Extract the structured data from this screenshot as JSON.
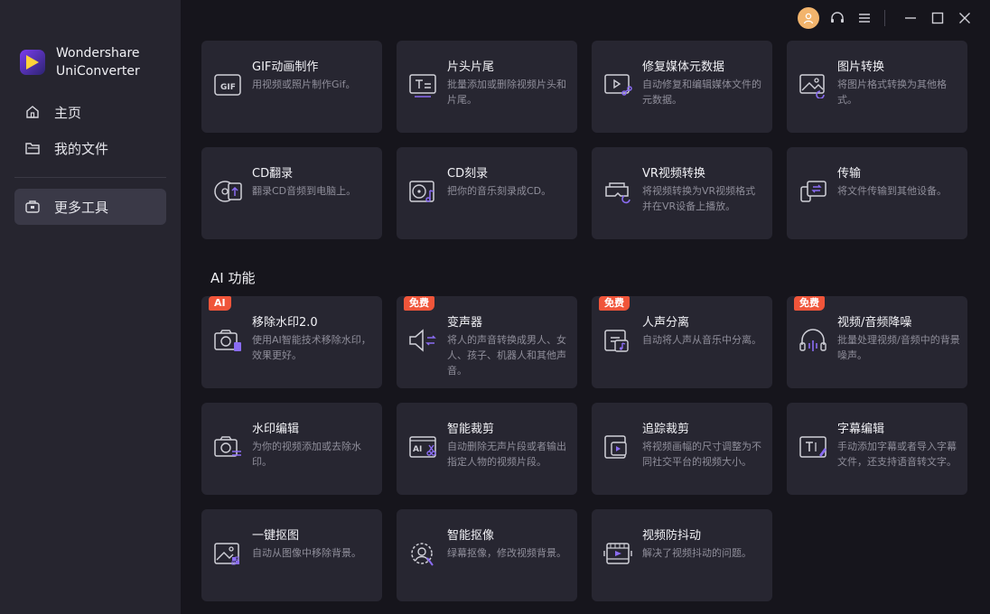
{
  "brand": {
    "line1": "Wondershare",
    "line2": "UniConverter"
  },
  "nav": [
    {
      "label": "主页",
      "icon": "home-icon"
    },
    {
      "label": "我的文件",
      "icon": "folder-icon"
    },
    {
      "label": "更多工具",
      "icon": "toolbox-icon",
      "active": true
    }
  ],
  "topbar": {
    "icons": [
      "user-avatar-icon",
      "headset-support-icon",
      "menu-icon",
      "minimize-icon",
      "maximize-icon",
      "close-icon"
    ]
  },
  "tools_top": [
    {
      "title": "GIF动画制作",
      "desc": "用视频或照片制作Gif。",
      "icon": "gif-icon"
    },
    {
      "title": "片头片尾",
      "desc": "批量添加或删除视频片头和片尾。",
      "icon": "intro-outro-icon"
    },
    {
      "title": "修复媒体元数据",
      "desc": "自动修复和编辑媒体文件的元数据。",
      "icon": "metadata-icon"
    },
    {
      "title": "图片转换",
      "desc": "将图片格式转换为其他格式。",
      "icon": "image-convert-icon"
    },
    {
      "title": "CD翻录",
      "desc": "翻录CD音频到电脑上。",
      "icon": "cd-ripper-icon"
    },
    {
      "title": "CD刻录",
      "desc": "把你的音乐刻录成CD。",
      "icon": "cd-burner-icon"
    },
    {
      "title": "VR视频转换",
      "desc": "将视频转换为VR视频格式并在VR设备上播放。",
      "icon": "vr-icon"
    },
    {
      "title": "传输",
      "desc": "将文件传输到其他设备。",
      "icon": "transfer-icon"
    }
  ],
  "ai_section_title": "AI 功能",
  "tools_ai": [
    {
      "title": "移除水印2.0",
      "desc": "使用AI智能技术移除水印，效果更好。",
      "badge": "AI",
      "icon": "watermark-remove-icon"
    },
    {
      "title": "变声器",
      "desc": "将人的声音转换成男人、女人、孩子、机器人和其他声音。",
      "badge": "免费",
      "icon": "voice-changer-icon"
    },
    {
      "title": "人声分离",
      "desc": "自动将人声从音乐中分离。",
      "badge": "免费",
      "icon": "vocal-remover-icon"
    },
    {
      "title": "视频/音频降噪",
      "desc": "批量处理视频/音频中的背景噪声。",
      "badge": "免费",
      "icon": "noise-reduction-icon"
    },
    {
      "title": "水印编辑",
      "desc": "为你的视频添加或去除水印。",
      "icon": "watermark-edit-icon"
    },
    {
      "title": "智能裁剪",
      "desc": "自动删除无声片段或者输出指定人物的视频片段。",
      "icon": "smart-trim-icon"
    },
    {
      "title": "追踪裁剪",
      "desc": "将视频画幅的尺寸调整为不同社交平台的视频大小。",
      "icon": "auto-reframe-icon"
    },
    {
      "title": "字幕编辑",
      "desc": "手动添加字幕或者导入字幕文件，还支持语音转文字。",
      "icon": "subtitle-icon"
    },
    {
      "title": "一键抠图",
      "desc": "自动从图像中移除背景。",
      "icon": "bg-remover-icon"
    },
    {
      "title": "智能抠像",
      "desc": "绿幕抠像，修改视频背景。",
      "icon": "smart-cutout-icon"
    },
    {
      "title": "视频防抖动",
      "desc": "解决了视频抖动的问题。",
      "icon": "stabilization-icon"
    }
  ],
  "colors": {
    "sidebar_bg": "#26252f",
    "main_bg": "#16151c",
    "card_bg": "#272631",
    "accent": "#8a6cf2",
    "badge": "#f0553a"
  }
}
